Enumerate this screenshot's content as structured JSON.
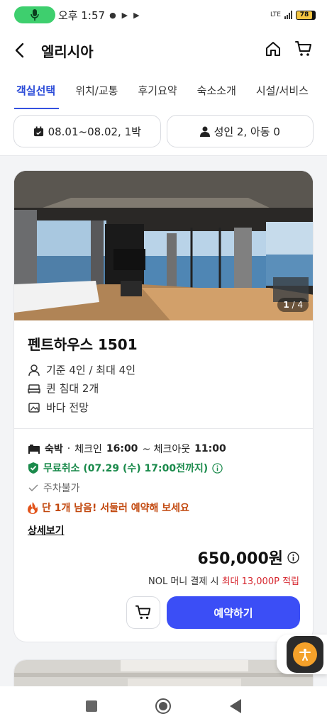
{
  "status_bar": {
    "time": "오후 1:57",
    "battery": "78",
    "network": "LTE"
  },
  "header": {
    "title": "엘리시아",
    "back_icon": "chevron-left-icon",
    "home_icon": "home-icon",
    "cart_icon": "cart-icon"
  },
  "tabs": [
    {
      "label": "객실선택",
      "active": true
    },
    {
      "label": "위치/교통",
      "active": false
    },
    {
      "label": "후기요약",
      "active": false
    },
    {
      "label": "숙소소개",
      "active": false
    },
    {
      "label": "시설/서비스",
      "active": false
    }
  ],
  "filters": {
    "dates": "08.01~08.02, 1박",
    "guests": "성인 2, 아동 0"
  },
  "room": {
    "photo_index": "1",
    "photo_total": "/ 4",
    "name": "펜트하우스 1501",
    "features": [
      {
        "icon": "person-icon",
        "label": "기준 4인 / 최대 4인"
      },
      {
        "icon": "bed-icon",
        "label": "퀸 침대 2개"
      },
      {
        "icon": "image-icon",
        "label": "바다 전망"
      }
    ],
    "stay_type": "숙박",
    "separator": "·",
    "checkin_label": "체크인",
    "checkin_time": "16:00",
    "checkout_label": "~ 체크아웃",
    "checkout_time": "11:00",
    "free_cancel": "무료취소 (07.29 (수) 17:00전까지)",
    "parking": "주차불가",
    "urgent": "단 1개 남음! 서둘러 예약해 보세요",
    "detail_link": "상세보기",
    "price": "650,000원",
    "point_prefix": "NOL 머니 결제 시",
    "point_highlight": "최대 13,000P 적립",
    "book_button": "예약하기"
  },
  "colors": {
    "accent": "#3b4ef6",
    "tab_active": "#2b4bd8",
    "cancel_green": "#1a8a4b",
    "urgent_orange": "#c2480e",
    "point_red": "#d6262e"
  }
}
